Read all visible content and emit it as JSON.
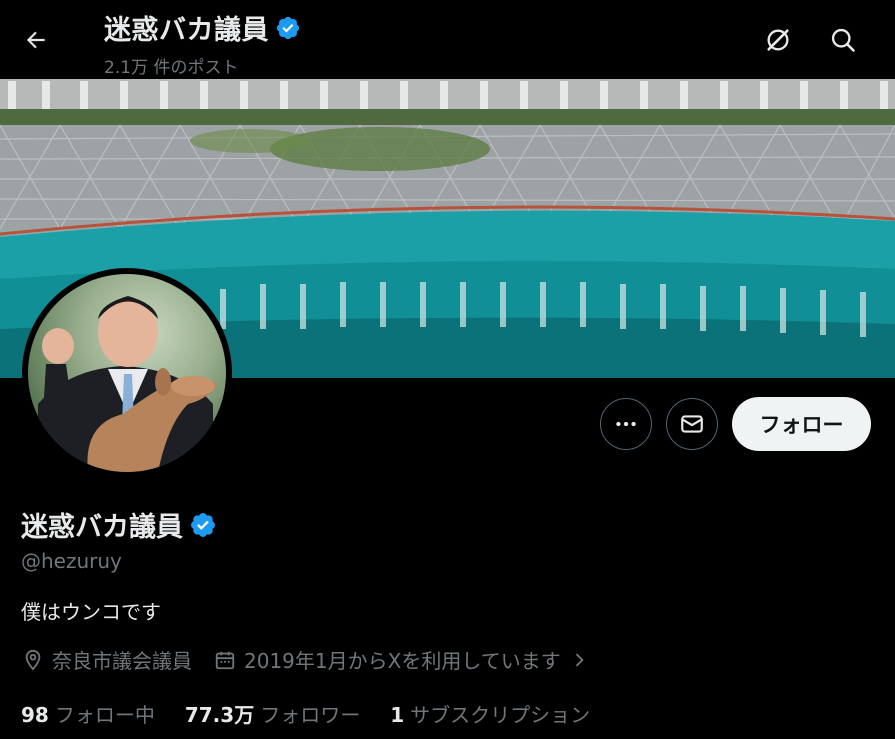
{
  "header": {
    "title": "迷惑バカ議員",
    "post_count": "2.1万 件のポスト"
  },
  "profile": {
    "display_name": "迷惑バカ議員",
    "handle": "@hezuruy",
    "bio": "僕はウンコです",
    "location": "奈良市議会議員",
    "joined": "2019年1月からXを利用しています",
    "verified": true
  },
  "actions": {
    "follow_label": "フォロー"
  },
  "stats": {
    "following_count": "98",
    "following_label": "フォロー中",
    "followers_count": "77.3万",
    "followers_label": "フォロワー",
    "subscriptions_count": "1",
    "subscriptions_label": "サブスクリプション"
  },
  "icons": {
    "back": "back-arrow-icon",
    "grok": "grok-icon",
    "search": "search-icon",
    "more": "more-icon",
    "message": "envelope-icon",
    "verified": "verified-badge-icon",
    "location": "location-pin-icon",
    "calendar": "calendar-icon",
    "chevron": "chevron-right-icon"
  },
  "colors": {
    "background": "#000000",
    "text_primary": "#e7e9ea",
    "text_secondary": "#71767b",
    "verified_blue": "#1d9bf0",
    "follow_button_bg": "#eff3f4",
    "border": "#536471"
  }
}
